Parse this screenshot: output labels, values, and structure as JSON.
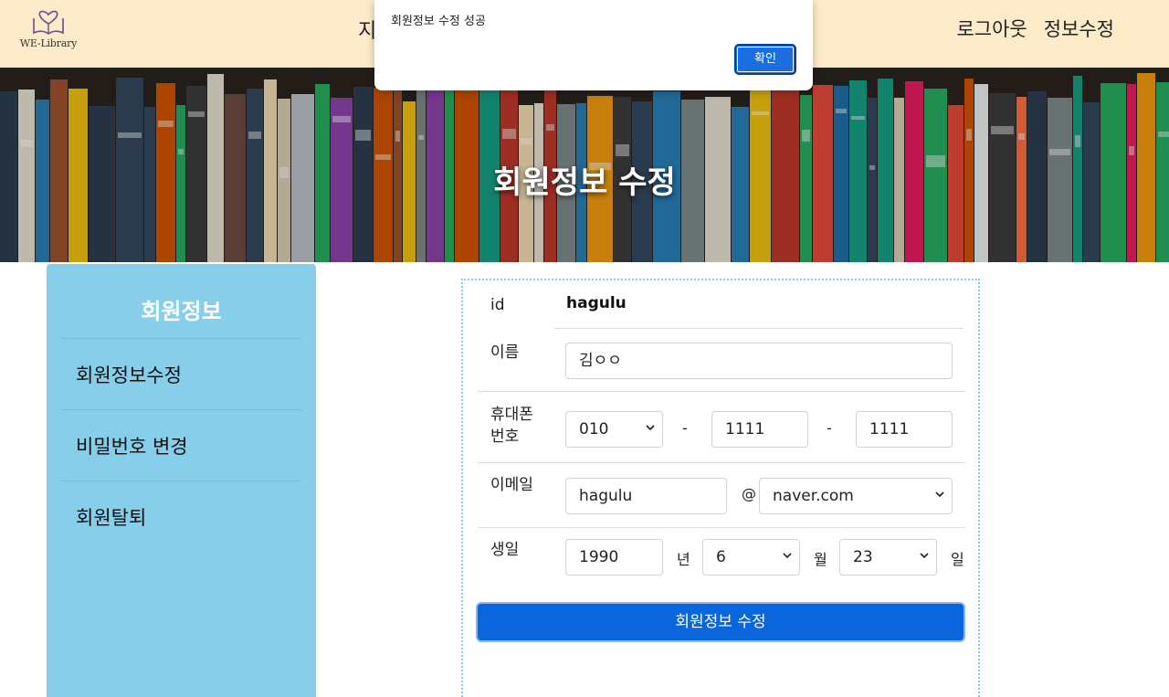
{
  "header": {
    "logo_text": "WE-Library",
    "nav_partial": "지",
    "nav_right": [
      "로그아웃",
      "정보수정"
    ]
  },
  "banner": {
    "title": "회원정보 수정"
  },
  "sidebar": {
    "title": "회원정보",
    "items": [
      {
        "label": "회원정보수정"
      },
      {
        "label": "비밀번호 변경"
      },
      {
        "label": "회원탈퇴"
      }
    ]
  },
  "form": {
    "id_label": "id",
    "id_value": "hagulu",
    "name_label": "이름",
    "name_value": "김ㅇㅇ",
    "phone_label_line1": "휴대폰",
    "phone_label_line2": "번호",
    "phone_prefix": "010",
    "phone_sep": "-",
    "phone_mid": "1111",
    "phone_last": "1111",
    "email_label": "이메일",
    "email_local": "hagulu",
    "email_at": "@",
    "email_domain": "naver.com",
    "birth_label": "생일",
    "birth_year": "1990",
    "year_suffix": "년",
    "birth_month": "6",
    "month_suffix": "월",
    "birth_day": "23",
    "day_suffix": "일",
    "submit_label": "회원정보 수정"
  },
  "dialog": {
    "message": "회원정보 수정 성공",
    "ok_label": "확인"
  },
  "colors": {
    "header_bg": "#fdebc9",
    "sidebar_bg": "#87ceeb",
    "primary": "#0b66dd"
  }
}
